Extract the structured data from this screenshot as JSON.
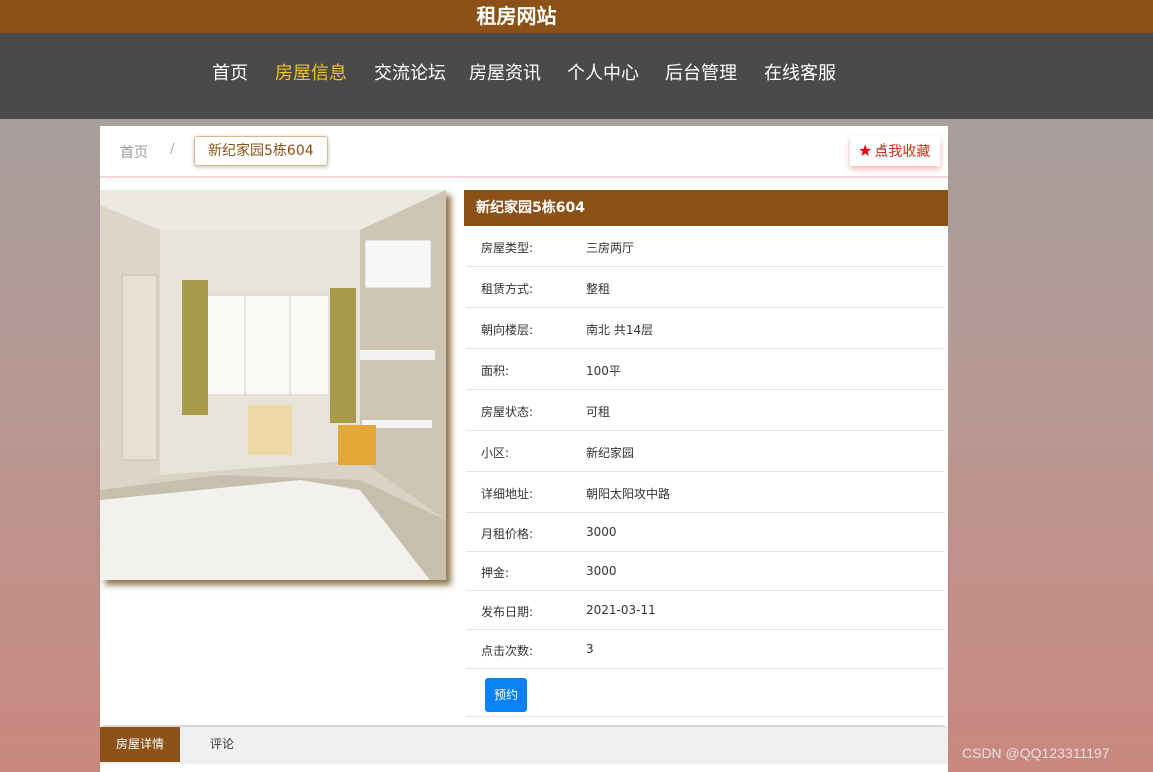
{
  "header": {
    "title": "租房网站"
  },
  "nav": [
    {
      "label": "首页"
    },
    {
      "label": "房屋信息"
    },
    {
      "label": "交流论坛"
    },
    {
      "label": "房屋资讯"
    },
    {
      "label": "个人中心"
    },
    {
      "label": "后台管理"
    },
    {
      "label": "在线客服"
    }
  ],
  "nav_active": "房屋信息",
  "breadcrumb": {
    "home": "首页",
    "separator": "/",
    "current": "新纪家园5栋604"
  },
  "favorite": {
    "label": "点我收藏",
    "icon": "star-icon"
  },
  "house": {
    "title": "新纪家园5栋604",
    "fields": [
      {
        "label": "房屋类型:",
        "value": "三房两厅"
      },
      {
        "label": "租赁方式:",
        "value": "整租"
      },
      {
        "label": "朝向楼层:",
        "value": "南北 共14层"
      },
      {
        "label": "面积:",
        "value": "100平"
      },
      {
        "label": "房屋状态:",
        "value": "可租"
      },
      {
        "label": "小区:",
        "value": "新纪家园"
      },
      {
        "label": "详细地址:",
        "value": "朝阳太阳攻中路"
      },
      {
        "label": "月租价格:",
        "value": "3000"
      },
      {
        "label": "押金:",
        "value": "3000"
      },
      {
        "label": "发布日期:",
        "value": "2021-03-11"
      },
      {
        "label": "点击次数:",
        "value": "3"
      }
    ],
    "book_label": "预约"
  },
  "tabs": [
    {
      "label": "房屋详情"
    },
    {
      "label": "评论"
    }
  ],
  "watermark": "CSDN @QQ123311197",
  "colors": {
    "brand": "#8b5117",
    "nav_bg": "#4a4a4a",
    "nav_active": "#f0c02d",
    "button": "#0a84f5"
  }
}
